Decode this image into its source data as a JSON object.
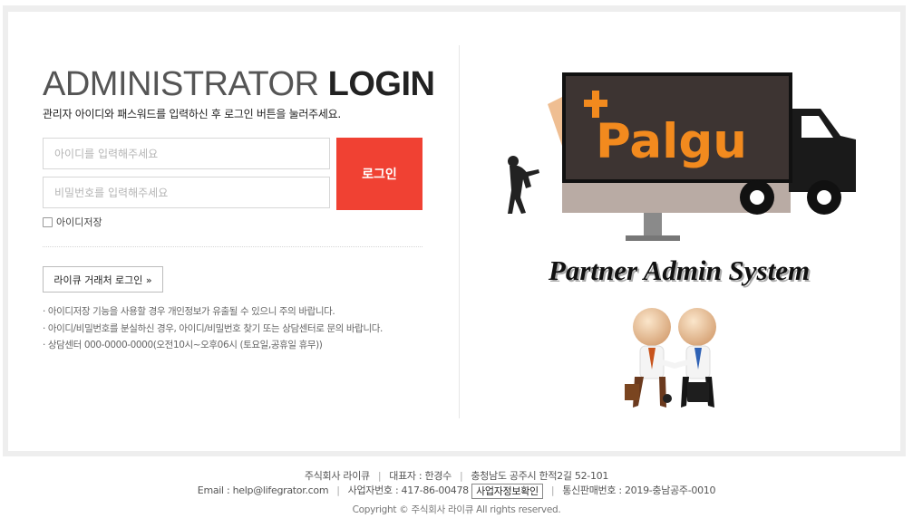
{
  "login": {
    "title_light": "ADMINISTRATOR",
    "title_bold": "LOGIN",
    "subtitle": "관리자 아이디와 패스워드를 입력하신 후 로그인 버튼을 눌러주세요.",
    "id_placeholder": "아이디를 입력해주세요",
    "pw_placeholder": "비밀번호를 입력해주세요",
    "login_button": "로그인",
    "save_id_label": "아이디저장",
    "partner_login_button": "라이큐 거래처 로그인 »",
    "notes": [
      "아이디저장 기능을 사용할 경우 개인정보가 유출될 수 있으니 주의 바랍니다.",
      "아이디/비밀번호를 분실하신 경우, 아이디/비밀번호 찾기 또는 상담센터로 문의 바랍니다.",
      "상담센터 000-0000-0000(오전10시~오후06시 (토요일,공휴일 휴무))"
    ]
  },
  "illustration": {
    "logo_text": "Palgu",
    "system_title": "Partner Admin System"
  },
  "footer": {
    "company": "주식회사 라이큐",
    "ceo": "대표자 : 한경수",
    "address": "충청남도 공주시 한적2길 52-101",
    "email": "Email : help@lifegrator.com",
    "biz_no": "사업자번호 : 417-86-00478",
    "biz_verify_button": "사업자정보확인",
    "mail_order_no": "통신판매번호 : 2019-충남공주-0010",
    "copyright": "Copyright © 주식회사 라이큐 All rights reserved."
  },
  "colors": {
    "accent": "#f04133",
    "logo_orange": "#f28a1e",
    "screen_dark": "#3d3432"
  }
}
